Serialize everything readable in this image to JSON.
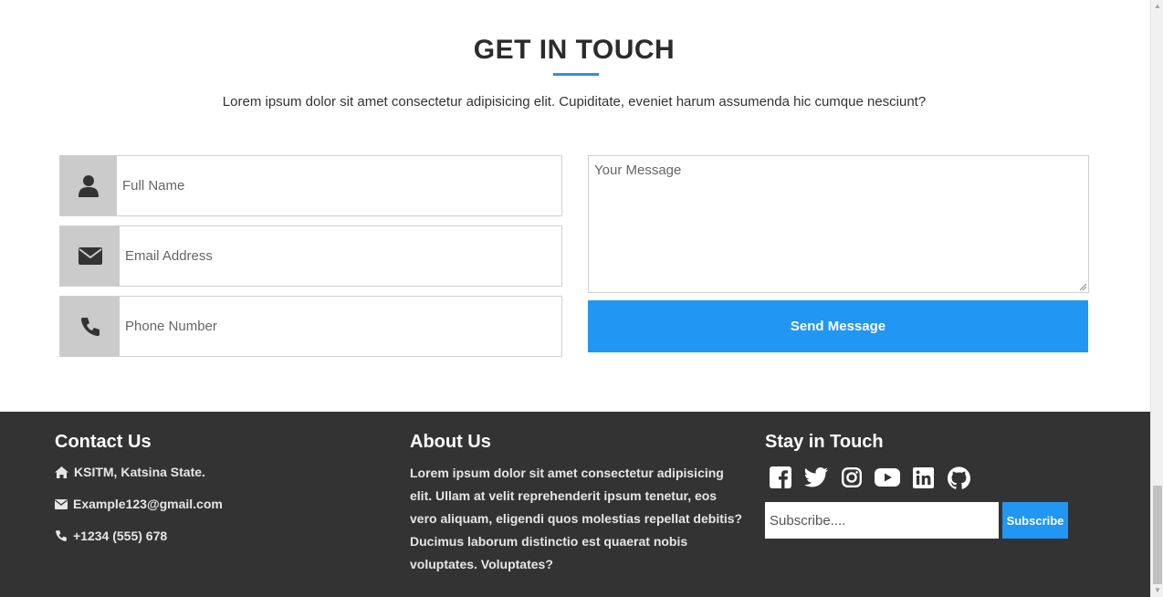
{
  "contact": {
    "title": "GET IN TOUCH",
    "description": "Lorem ipsum dolor sit amet consectetur adipisicing elit. Cupiditate, eveniet harum assumenda hic cumque nesciunt?",
    "fields": {
      "full_name_placeholder": "Full Name",
      "email_placeholder": "Email Address",
      "phone_placeholder": "Phone Number",
      "message_placeholder": "Your Message"
    },
    "send_label": "Send Message",
    "accent_color": "#2196f3"
  },
  "footer": {
    "background": "#333333",
    "contact_us": {
      "heading": "Contact Us",
      "address": "KSITM, Katsina State.",
      "email": "Example123@gmail.com",
      "phone": "+1234 (555) 678"
    },
    "about_us": {
      "heading": "About Us",
      "text": "Lorem ipsum dolor sit amet consectetur adipisicing elit. Ullam at velit reprehenderit ipsum tenetur, eos vero aliquam, eligendi quos molestias repellat debitis? Ducimus laborum distinctio est quaerat nobis voluptates. Voluptates?"
    },
    "stay_in_touch": {
      "heading": "Stay in Touch",
      "social_icons": [
        "facebook-icon",
        "twitter-icon",
        "instagram-icon",
        "youtube-icon",
        "linkedin-icon",
        "github-icon"
      ],
      "subscribe_placeholder": "Subscribe....",
      "subscribe_label": "Subscribe"
    }
  }
}
